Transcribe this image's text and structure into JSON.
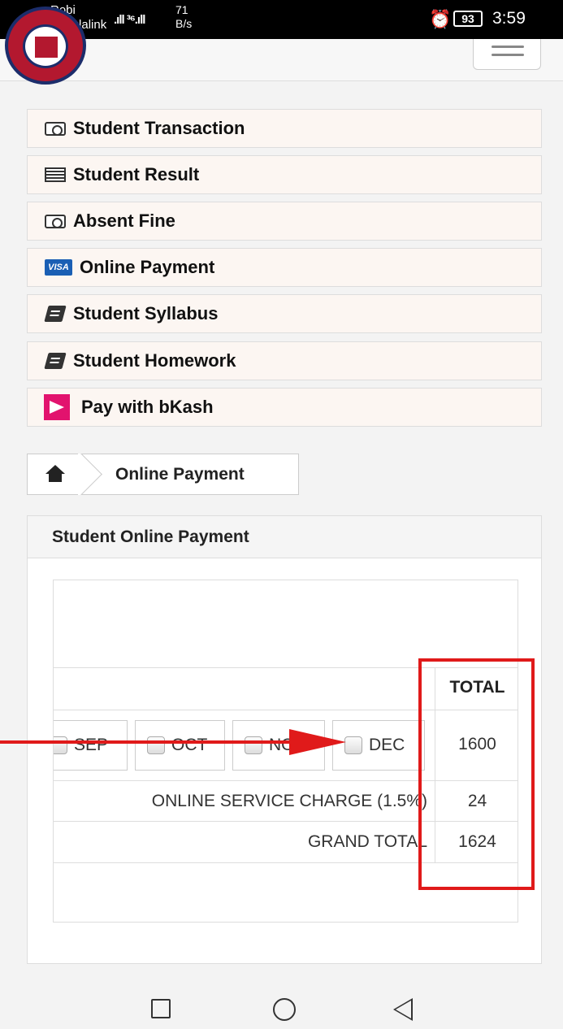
{
  "status_bar": {
    "carrier_1": "Robi",
    "carrier_2": "Banglalink",
    "signal": ".ıll ³⁶.ıll",
    "net_speed_value": "71",
    "net_speed_unit": "B/s",
    "alarm_icon": "alarm-clock-icon",
    "battery": "93",
    "time": "3:59"
  },
  "header": {
    "logo_icon": "school-logo-icon",
    "menu_icon": "hamburger-menu-icon"
  },
  "menu": {
    "items": [
      {
        "label": "Student Transaction",
        "icon": "money-bill-icon"
      },
      {
        "label": "Student Result",
        "icon": "list-icon"
      },
      {
        "label": "Absent Fine",
        "icon": "money-bill-icon"
      },
      {
        "label": "Online Payment",
        "icon": "visa-card-icon",
        "icon_text": "VISA"
      },
      {
        "label": "Student Syllabus",
        "icon": "book-icon"
      },
      {
        "label": "Student Homework",
        "icon": "book-icon"
      },
      {
        "label": "Pay with bKash",
        "icon": "bkash-icon"
      }
    ]
  },
  "breadcrumb": {
    "home_icon": "home-icon",
    "current": "Online Payment"
  },
  "panel": {
    "title": "Student Online Payment",
    "table": {
      "total_header": "TOTAL",
      "months": [
        {
          "label": "SEP",
          "checked": false
        },
        {
          "label": "OCT",
          "checked": false
        },
        {
          "label": "NOV",
          "checked": false
        },
        {
          "label": "DEC",
          "checked": false
        }
      ],
      "subtotal": "1600",
      "service_charge_label": "ONLINE SERVICE CHARGE (1.5%)",
      "service_charge": "24",
      "grand_total_label": "GRAND TOTAL",
      "grand_total": "1624"
    }
  },
  "annotation": {
    "color": "#e01a1a"
  },
  "nav_bar": {
    "recents_icon": "square-recents-icon",
    "home_icon": "circle-home-icon",
    "back_icon": "triangle-back-icon"
  }
}
